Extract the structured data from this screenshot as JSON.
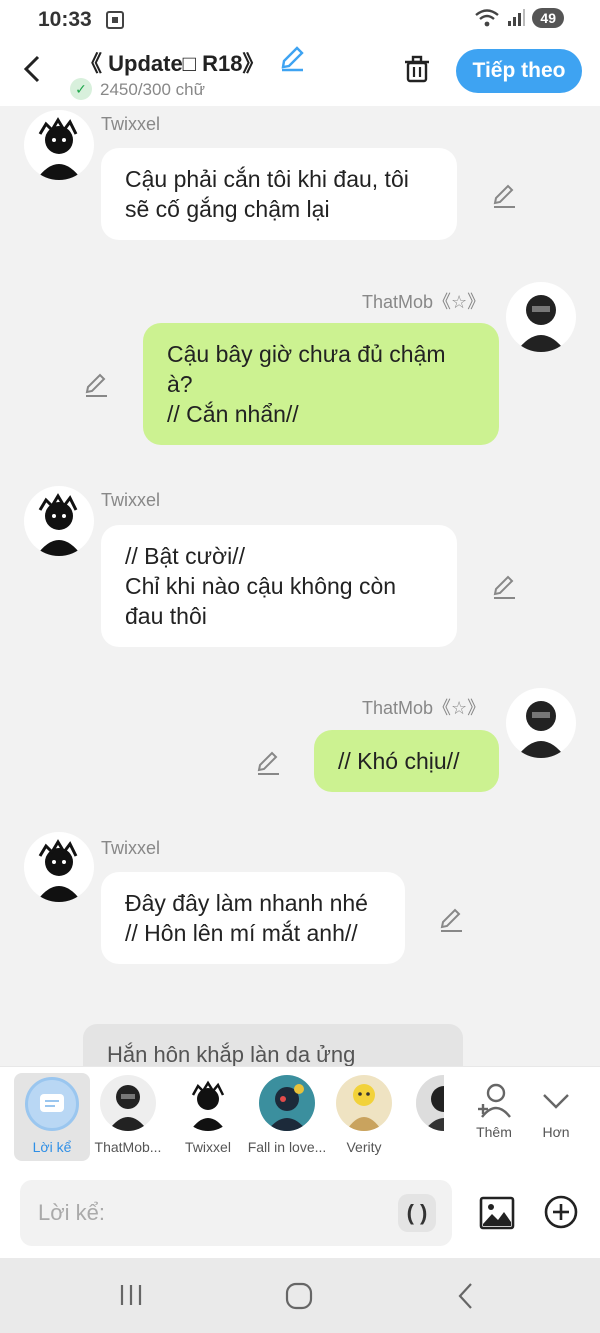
{
  "status_bar": {
    "time": "10:33",
    "battery": "49"
  },
  "header": {
    "title": "《 Update□ R18》",
    "word_count": "2450/300 chữ",
    "next_button": "Tiếp theo"
  },
  "messages": [
    {
      "side": "left",
      "name": "Twixxel",
      "text": "Cậu phải cắn tôi khi đau, tôi\nsẽ cố gắng chậm lại"
    },
    {
      "side": "right",
      "name": "ThatMob《☆》",
      "text": "Cậu bây giờ chưa đủ chậm\nà?\n// Cắn nhẩn//"
    },
    {
      "side": "left",
      "name": "Twixxel",
      "text": "// Bật cười//\nChỉ khi nào cậu không còn\nđau thôi"
    },
    {
      "side": "right",
      "name": "ThatMob《☆》",
      "text": "// Khó chịu//"
    },
    {
      "side": "left",
      "name": "Twixxel",
      "text": "Đây đây làm nhanh nhé\n// Hôn lên mí mắt anh//"
    }
  ],
  "draft_text": "Hắn hôn khắp làn da ửng",
  "characters": [
    {
      "label": "Lời kể",
      "selected": true
    },
    {
      "label": "ThatMob..."
    },
    {
      "label": "Twixxel"
    },
    {
      "label": "Fall in love..."
    },
    {
      "label": "Verity"
    }
  ],
  "tools": {
    "more_chars": "Thêm",
    "expand": "Hơn"
  },
  "input": {
    "placeholder": "Lời kể:",
    "paren_button": "( )"
  },
  "colors": {
    "accent": "#3ea3f2",
    "right_bubble": "#ccf291",
    "left_bubble": "#ffffff"
  }
}
